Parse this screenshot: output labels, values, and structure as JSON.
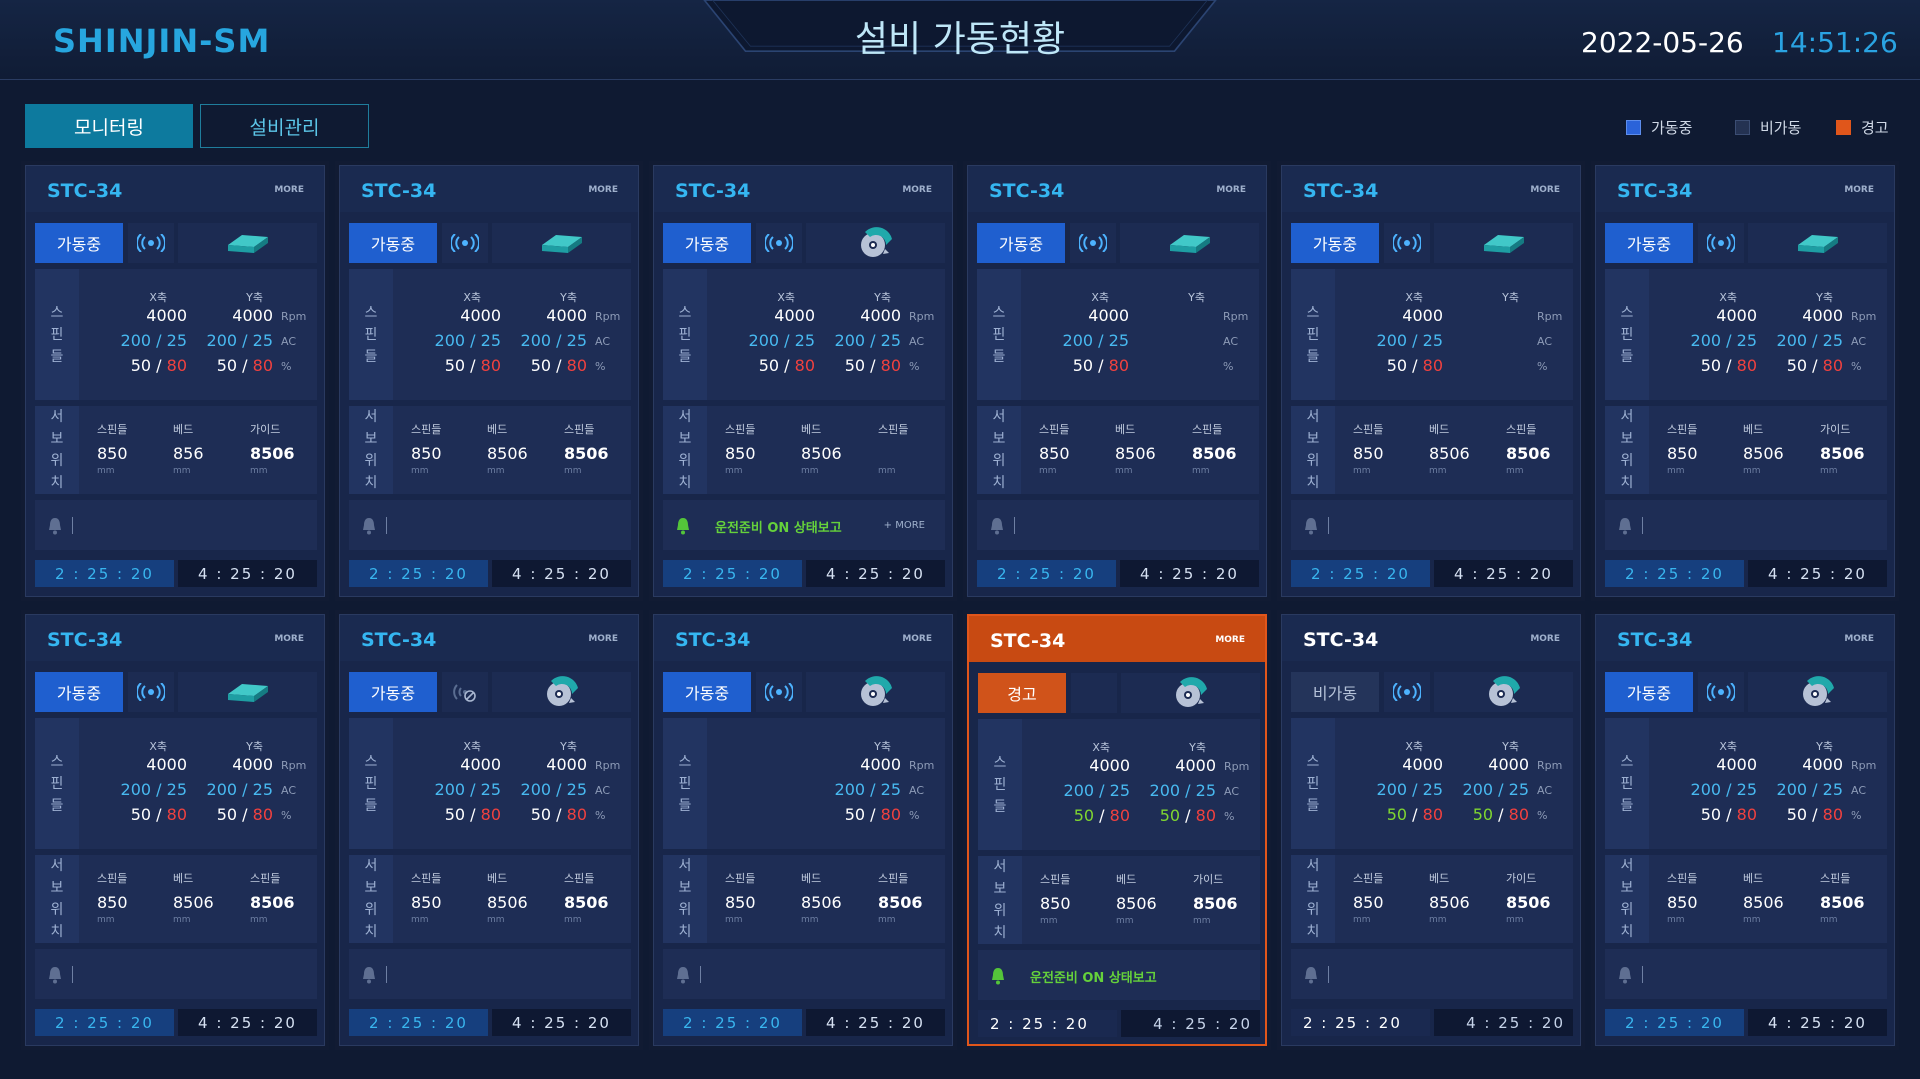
{
  "header": {
    "logo": "SHINJIN-SM",
    "title": "설비 가동현황",
    "date": "2022-05-26",
    "time": "14:51:26"
  },
  "tabs": [
    {
      "label": "모니터링",
      "active": true
    },
    {
      "label": "설비관리",
      "active": false
    }
  ],
  "legend": [
    {
      "label": "가동중",
      "color": "#2b63d9"
    },
    {
      "label": "비가동",
      "color": "#243252"
    },
    {
      "label": "경고",
      "color": "#e0561b"
    }
  ],
  "labels": {
    "more": "MORE",
    "spindle_vertical": [
      "스",
      "핀",
      "들"
    ],
    "servo_vertical": [
      "서",
      "보",
      "위",
      "치"
    ],
    "x_axis": "X축",
    "y_axis": "Y축",
    "unit_rpm": "Rpm",
    "unit_ac": "AC",
    "unit_pct": "%",
    "unit_mm": "mm",
    "alarm_more": "+ MORE"
  },
  "cards": [
    {
      "title": "STC-34",
      "status": "가동중",
      "state": "run",
      "signal": "on",
      "tool": "plate",
      "x": {
        "rpm": "4000",
        "ac": "200 / 25",
        "load": "50",
        "max": "80"
      },
      "y": {
        "rpm": "4000",
        "ac": "200 / 25",
        "load": "50",
        "max": "80"
      },
      "servo": [
        {
          "h": "스핀들",
          "v": "850"
        },
        {
          "h": "베드",
          "v": "856"
        },
        {
          "h": "가이드",
          "v": "8506"
        }
      ],
      "alarm": "",
      "time1": "2 : 25 : 20",
      "time2": "4 : 25 : 20"
    },
    {
      "title": "STC-34",
      "status": "가동중",
      "state": "run",
      "signal": "on",
      "tool": "plate",
      "x": {
        "rpm": "4000",
        "ac": "200 / 25",
        "load": "50",
        "max": "80"
      },
      "y": {
        "rpm": "4000",
        "ac": "200 / 25",
        "load": "50",
        "max": "80"
      },
      "servo": [
        {
          "h": "스핀들",
          "v": "850"
        },
        {
          "h": "베드",
          "v": "8506"
        },
        {
          "h": "스핀들",
          "v": "8506"
        }
      ],
      "alarm": "",
      "time1": "2 : 25 : 20",
      "time2": "4 : 25 : 20"
    },
    {
      "title": "STC-34",
      "status": "가동중",
      "state": "run",
      "signal": "on",
      "tool": "saw",
      "x": {
        "rpm": "4000",
        "ac": "200 / 25",
        "load": "50",
        "max": "80"
      },
      "y": {
        "rpm": "4000",
        "ac": "200 / 25",
        "load": "50",
        "max": "80"
      },
      "servo": [
        {
          "h": "스핀들",
          "v": "850"
        },
        {
          "h": "베드",
          "v": "8506"
        },
        {
          "h": "스핀들",
          "v": ""
        }
      ],
      "alarm": "운전준비 ON 상태보고",
      "time1": "2 : 25 : 20",
      "time2": "4 : 25 : 20"
    },
    {
      "title": "STC-34",
      "status": "가동중",
      "state": "run",
      "signal": "on",
      "tool": "plate",
      "x": {
        "rpm": "4000",
        "ac": "200 / 25",
        "load": "50",
        "max": "80"
      },
      "y": {
        "rpm": "",
        "ac": "",
        "load": "",
        "max": ""
      },
      "servo": [
        {
          "h": "스핀들",
          "v": "850"
        },
        {
          "h": "베드",
          "v": "8506"
        },
        {
          "h": "스핀들",
          "v": "8506"
        }
      ],
      "alarm": "",
      "time1": "2 : 25 : 20",
      "time2": "4 : 25 : 20"
    },
    {
      "title": "STC-34",
      "status": "가동중",
      "state": "run",
      "signal": "on",
      "tool": "plate",
      "x": {
        "rpm": "4000",
        "ac": "200 / 25",
        "load": "50",
        "max": "80"
      },
      "y": {
        "rpm": "",
        "ac": "",
        "load": "",
        "max": ""
      },
      "servo": [
        {
          "h": "스핀들",
          "v": "850"
        },
        {
          "h": "베드",
          "v": "8506"
        },
        {
          "h": "스핀들",
          "v": "8506"
        }
      ],
      "alarm": "",
      "time1": "2 : 25 : 20",
      "time2": "4 : 25 : 20"
    },
    {
      "title": "STC-34",
      "status": "가동중",
      "state": "run",
      "signal": "on",
      "tool": "plate",
      "x": {
        "rpm": "4000",
        "ac": "200 / 25",
        "load": "50",
        "max": "80"
      },
      "y": {
        "rpm": "4000",
        "ac": "200 / 25",
        "load": "50",
        "max": "80"
      },
      "servo": [
        {
          "h": "스핀들",
          "v": "850"
        },
        {
          "h": "베드",
          "v": "8506"
        },
        {
          "h": "가이드",
          "v": "8506"
        }
      ],
      "alarm": "",
      "time1": "2 : 25 : 20",
      "time2": "4 : 25 : 20"
    },
    {
      "title": "STC-34",
      "status": "가동중",
      "state": "run",
      "signal": "on",
      "tool": "plate",
      "x": {
        "rpm": "4000",
        "ac": "200 / 25",
        "load": "50",
        "max": "80"
      },
      "y": {
        "rpm": "4000",
        "ac": "200 / 25",
        "load": "50",
        "max": "80"
      },
      "servo": [
        {
          "h": "스핀들",
          "v": "850"
        },
        {
          "h": "베드",
          "v": "8506"
        },
        {
          "h": "스핀들",
          "v": "8506"
        }
      ],
      "alarm": "",
      "time1": "2 : 25 : 20",
      "time2": "4 : 25 : 20"
    },
    {
      "title": "STC-34",
      "status": "가동중",
      "state": "run",
      "signal": "off",
      "tool": "saw",
      "x": {
        "rpm": "4000",
        "ac": "200 / 25",
        "load": "50",
        "max": "80"
      },
      "y": {
        "rpm": "4000",
        "ac": "200 / 25",
        "load": "50",
        "max": "80"
      },
      "servo": [
        {
          "h": "스핀들",
          "v": "850"
        },
        {
          "h": "베드",
          "v": "8506"
        },
        {
          "h": "스핀들",
          "v": "8506"
        }
      ],
      "alarm": "",
      "time1": "2 : 25 : 20",
      "time2": "4 : 25 : 20"
    },
    {
      "title": "STC-34",
      "status": "가동중",
      "state": "run",
      "signal": "on",
      "tool": "saw",
      "x": {
        "rpm": "",
        "ac": "",
        "load": "",
        "max": ""
      },
      "y": {
        "rpm": "4000",
        "ac": "200 / 25",
        "load": "50",
        "max": "80"
      },
      "servo": [
        {
          "h": "스핀들",
          "v": "850"
        },
        {
          "h": "베드",
          "v": "8506"
        },
        {
          "h": "스핀들",
          "v": "8506"
        }
      ],
      "alarm": "",
      "time1": "2 : 25 : 20",
      "time2": "4 : 25 : 20"
    },
    {
      "title": "STC-34",
      "status": "경고",
      "state": "warn",
      "signal": "none",
      "tool": "saw",
      "x": {
        "rpm": "4000",
        "ac": "200 / 25",
        "load": "50",
        "max": "80"
      },
      "y": {
        "rpm": "4000",
        "ac": "200 / 25",
        "load": "50",
        "max": "80"
      },
      "servo": [
        {
          "h": "스핀들",
          "v": "850"
        },
        {
          "h": "베드",
          "v": "8506"
        },
        {
          "h": "가이드",
          "v": "8506"
        }
      ],
      "alarm": "운전준비 ON 상태보고",
      "time1": "2 : 25 : 20",
      "time2": "4 : 25 : 20"
    },
    {
      "title": "STC-34",
      "status": "비가동",
      "state": "idle",
      "signal": "on",
      "tool": "saw",
      "x": {
        "rpm": "4000",
        "ac": "200 / 25",
        "load": "50",
        "max": "80"
      },
      "y": {
        "rpm": "4000",
        "ac": "200 / 25",
        "load": "50",
        "max": "80"
      },
      "servo": [
        {
          "h": "스핀들",
          "v": "850"
        },
        {
          "h": "베드",
          "v": "8506"
        },
        {
          "h": "가이드",
          "v": "8506"
        }
      ],
      "alarm": "",
      "time1": "2 : 25 : 20",
      "time2": "4 : 25 : 20"
    },
    {
      "title": "STC-34",
      "status": "가동중",
      "state": "run",
      "signal": "on",
      "tool": "saw",
      "x": {
        "rpm": "4000",
        "ac": "200 / 25",
        "load": "50",
        "max": "80"
      },
      "y": {
        "rpm": "4000",
        "ac": "200 / 25",
        "load": "50",
        "max": "80"
      },
      "servo": [
        {
          "h": "스핀들",
          "v": "850"
        },
        {
          "h": "베드",
          "v": "8506"
        },
        {
          "h": "스핀들",
          "v": "8506"
        }
      ],
      "alarm": "",
      "time1": "2 : 25 : 20",
      "time2": "4 : 25 : 20"
    }
  ]
}
